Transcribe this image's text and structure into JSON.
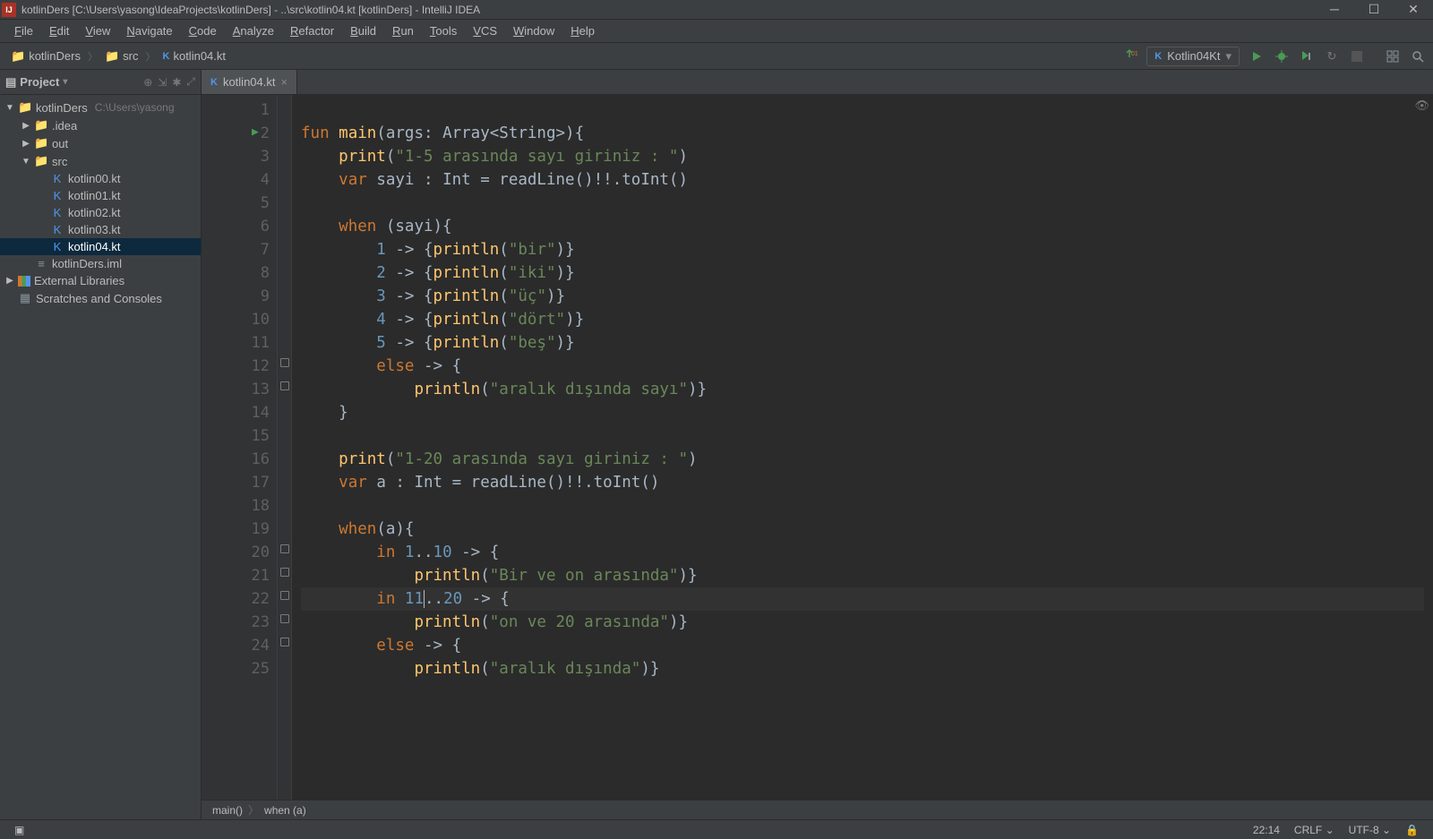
{
  "titleBar": {
    "text": "kotlinDers [C:\\Users\\yasong\\IdeaProjects\\kotlinDers] - ..\\src\\kotlin04.kt [kotlinDers] - IntelliJ IDEA"
  },
  "menu": [
    "File",
    "Edit",
    "View",
    "Navigate",
    "Code",
    "Analyze",
    "Refactor",
    "Build",
    "Run",
    "Tools",
    "VCS",
    "Window",
    "Help"
  ],
  "breadcrumbs": [
    {
      "icon": "folder",
      "label": "kotlinDers"
    },
    {
      "icon": "folder",
      "label": "src"
    },
    {
      "icon": "kt",
      "label": "kotlin04.kt"
    }
  ],
  "runConfig": "Kotlin04Kt",
  "projectPanel": {
    "title": "Project",
    "tree": [
      {
        "depth": 0,
        "arrow": "▼",
        "iconClass": "folder-blue",
        "icon": "📁",
        "label": "kotlinDers",
        "path": "C:\\Users\\yasong"
      },
      {
        "depth": 1,
        "arrow": "▶",
        "iconClass": "folder-grey",
        "icon": "📁",
        "label": ".idea"
      },
      {
        "depth": 1,
        "arrow": "▶",
        "iconClass": "folder-orange",
        "icon": "📁",
        "label": "out"
      },
      {
        "depth": 1,
        "arrow": "▼",
        "iconClass": "folder-blue",
        "icon": "📁",
        "label": "src"
      },
      {
        "depth": 2,
        "arrow": "",
        "iconClass": "kt-icon",
        "icon": "K",
        "label": "kotlin00.kt"
      },
      {
        "depth": 2,
        "arrow": "",
        "iconClass": "kt-icon",
        "icon": "K",
        "label": "kotlin01.kt"
      },
      {
        "depth": 2,
        "arrow": "",
        "iconClass": "kt-icon",
        "icon": "K",
        "label": "kotlin02.kt"
      },
      {
        "depth": 2,
        "arrow": "",
        "iconClass": "kt-icon",
        "icon": "K",
        "label": "kotlin03.kt"
      },
      {
        "depth": 2,
        "arrow": "",
        "iconClass": "kt-icon",
        "icon": "K",
        "label": "kotlin04.kt",
        "selected": true
      },
      {
        "depth": 1,
        "arrow": "",
        "iconClass": "iml-icon",
        "icon": "≡",
        "label": "kotlinDers.iml"
      },
      {
        "depth": 0,
        "arrow": "▶",
        "iconClass": "",
        "icon": "",
        "label": "External Libraries",
        "libIcon": true
      },
      {
        "depth": 0,
        "arrow": "",
        "iconClass": "folder-grey",
        "icon": "▦",
        "label": "Scratches and Consoles"
      }
    ]
  },
  "editor": {
    "tabLabel": "kotlin04.kt",
    "lineStart": 1,
    "lineEnd": 25,
    "runGutterLine": 2,
    "highlightedLine": 22,
    "code": [
      {
        "n": 1,
        "tokens": []
      },
      {
        "n": 2,
        "tokens": [
          {
            "t": "kw",
            "v": "fun "
          },
          {
            "t": "fn",
            "v": "main"
          },
          {
            "t": "op",
            "v": "(args: Array<String>){"
          }
        ]
      },
      {
        "n": 3,
        "tokens": [
          {
            "t": "op",
            "v": "    "
          },
          {
            "t": "fn",
            "v": "print"
          },
          {
            "t": "op",
            "v": "("
          },
          {
            "t": "str",
            "v": "\"1-5 arasında sayı giriniz : \""
          },
          {
            "t": "op",
            "v": ")"
          }
        ]
      },
      {
        "n": 4,
        "tokens": [
          {
            "t": "op",
            "v": "    "
          },
          {
            "t": "kw",
            "v": "var "
          },
          {
            "t": "op",
            "v": "sayi : Int = readLine()!!.toInt()"
          }
        ]
      },
      {
        "n": 5,
        "tokens": []
      },
      {
        "n": 6,
        "tokens": [
          {
            "t": "op",
            "v": "    "
          },
          {
            "t": "kw",
            "v": "when "
          },
          {
            "t": "op",
            "v": "(sayi){"
          }
        ]
      },
      {
        "n": 7,
        "tokens": [
          {
            "t": "op",
            "v": "        "
          },
          {
            "t": "num",
            "v": "1"
          },
          {
            "t": "op",
            "v": " -> {"
          },
          {
            "t": "fn",
            "v": "println"
          },
          {
            "t": "op",
            "v": "("
          },
          {
            "t": "str",
            "v": "\"bir\""
          },
          {
            "t": "op",
            "v": ")}"
          }
        ]
      },
      {
        "n": 8,
        "tokens": [
          {
            "t": "op",
            "v": "        "
          },
          {
            "t": "num",
            "v": "2"
          },
          {
            "t": "op",
            "v": " -> {"
          },
          {
            "t": "fn",
            "v": "println"
          },
          {
            "t": "op",
            "v": "("
          },
          {
            "t": "str",
            "v": "\"iki\""
          },
          {
            "t": "op",
            "v": ")}"
          }
        ]
      },
      {
        "n": 9,
        "tokens": [
          {
            "t": "op",
            "v": "        "
          },
          {
            "t": "num",
            "v": "3"
          },
          {
            "t": "op",
            "v": " -> {"
          },
          {
            "t": "fn",
            "v": "println"
          },
          {
            "t": "op",
            "v": "("
          },
          {
            "t": "str",
            "v": "\"üç\""
          },
          {
            "t": "op",
            "v": ")}"
          }
        ]
      },
      {
        "n": 10,
        "tokens": [
          {
            "t": "op",
            "v": "        "
          },
          {
            "t": "num",
            "v": "4"
          },
          {
            "t": "op",
            "v": " -> {"
          },
          {
            "t": "fn",
            "v": "println"
          },
          {
            "t": "op",
            "v": "("
          },
          {
            "t": "str",
            "v": "\"dört\""
          },
          {
            "t": "op",
            "v": ")}"
          }
        ]
      },
      {
        "n": 11,
        "tokens": [
          {
            "t": "op",
            "v": "        "
          },
          {
            "t": "num",
            "v": "5"
          },
          {
            "t": "op",
            "v": " -> {"
          },
          {
            "t": "fn",
            "v": "println"
          },
          {
            "t": "op",
            "v": "("
          },
          {
            "t": "str",
            "v": "\"beş\""
          },
          {
            "t": "op",
            "v": ")}"
          }
        ]
      },
      {
        "n": 12,
        "tokens": [
          {
            "t": "op",
            "v": "        "
          },
          {
            "t": "kw",
            "v": "else"
          },
          {
            "t": "op",
            "v": " -> {"
          }
        ]
      },
      {
        "n": 13,
        "tokens": [
          {
            "t": "op",
            "v": "            "
          },
          {
            "t": "fn",
            "v": "println"
          },
          {
            "t": "op",
            "v": "("
          },
          {
            "t": "str",
            "v": "\"aralık dışında sayı\""
          },
          {
            "t": "op",
            "v": ")}"
          }
        ]
      },
      {
        "n": 14,
        "tokens": [
          {
            "t": "op",
            "v": "    }"
          }
        ]
      },
      {
        "n": 15,
        "tokens": []
      },
      {
        "n": 16,
        "tokens": [
          {
            "t": "op",
            "v": "    "
          },
          {
            "t": "fn",
            "v": "print"
          },
          {
            "t": "op",
            "v": "("
          },
          {
            "t": "str",
            "v": "\"1-20 arasında sayı giriniz : \""
          },
          {
            "t": "op",
            "v": ")"
          }
        ]
      },
      {
        "n": 17,
        "tokens": [
          {
            "t": "op",
            "v": "    "
          },
          {
            "t": "kw",
            "v": "var "
          },
          {
            "t": "op",
            "v": "a : Int = readLine()!!.toInt()"
          }
        ]
      },
      {
        "n": 18,
        "tokens": []
      },
      {
        "n": 19,
        "tokens": [
          {
            "t": "op",
            "v": "    "
          },
          {
            "t": "kw",
            "v": "when"
          },
          {
            "t": "op",
            "v": "(a){"
          }
        ]
      },
      {
        "n": 20,
        "tokens": [
          {
            "t": "op",
            "v": "        "
          },
          {
            "t": "kw",
            "v": "in "
          },
          {
            "t": "num",
            "v": "1"
          },
          {
            "t": "op",
            "v": ".."
          },
          {
            "t": "num",
            "v": "10"
          },
          {
            "t": "op",
            "v": " -> {"
          }
        ]
      },
      {
        "n": 21,
        "tokens": [
          {
            "t": "op",
            "v": "            "
          },
          {
            "t": "fn",
            "v": "println"
          },
          {
            "t": "op",
            "v": "("
          },
          {
            "t": "str",
            "v": "\"Bir ve on arasında\""
          },
          {
            "t": "op",
            "v": ")}"
          }
        ]
      },
      {
        "n": 22,
        "tokens": [
          {
            "t": "op",
            "v": "        "
          },
          {
            "t": "kw",
            "v": "in "
          },
          {
            "t": "num",
            "v": "11"
          },
          {
            "t": "caret",
            "v": ""
          },
          {
            "t": "op",
            "v": ".."
          },
          {
            "t": "num",
            "v": "20"
          },
          {
            "t": "op",
            "v": " -> {"
          }
        ]
      },
      {
        "n": 23,
        "tokens": [
          {
            "t": "op",
            "v": "            "
          },
          {
            "t": "fn",
            "v": "println"
          },
          {
            "t": "op",
            "v": "("
          },
          {
            "t": "str",
            "v": "\"on ve 20 arasında\""
          },
          {
            "t": "op",
            "v": ")}"
          }
        ]
      },
      {
        "n": 24,
        "tokens": [
          {
            "t": "op",
            "v": "        "
          },
          {
            "t": "kw",
            "v": "else"
          },
          {
            "t": "op",
            "v": " -> {"
          }
        ]
      },
      {
        "n": 25,
        "tokens": [
          {
            "t": "op",
            "v": "            "
          },
          {
            "t": "fn",
            "v": "println"
          },
          {
            "t": "op",
            "v": "("
          },
          {
            "t": "str",
            "v": "\"aralık dışında\""
          },
          {
            "t": "op",
            "v": ")}"
          }
        ]
      }
    ],
    "bottomCrumbs": [
      "main()",
      "when (a)"
    ]
  },
  "statusBar": {
    "cursor": "22:14",
    "lineSep": "CRLF",
    "encoding": "UTF-8"
  }
}
